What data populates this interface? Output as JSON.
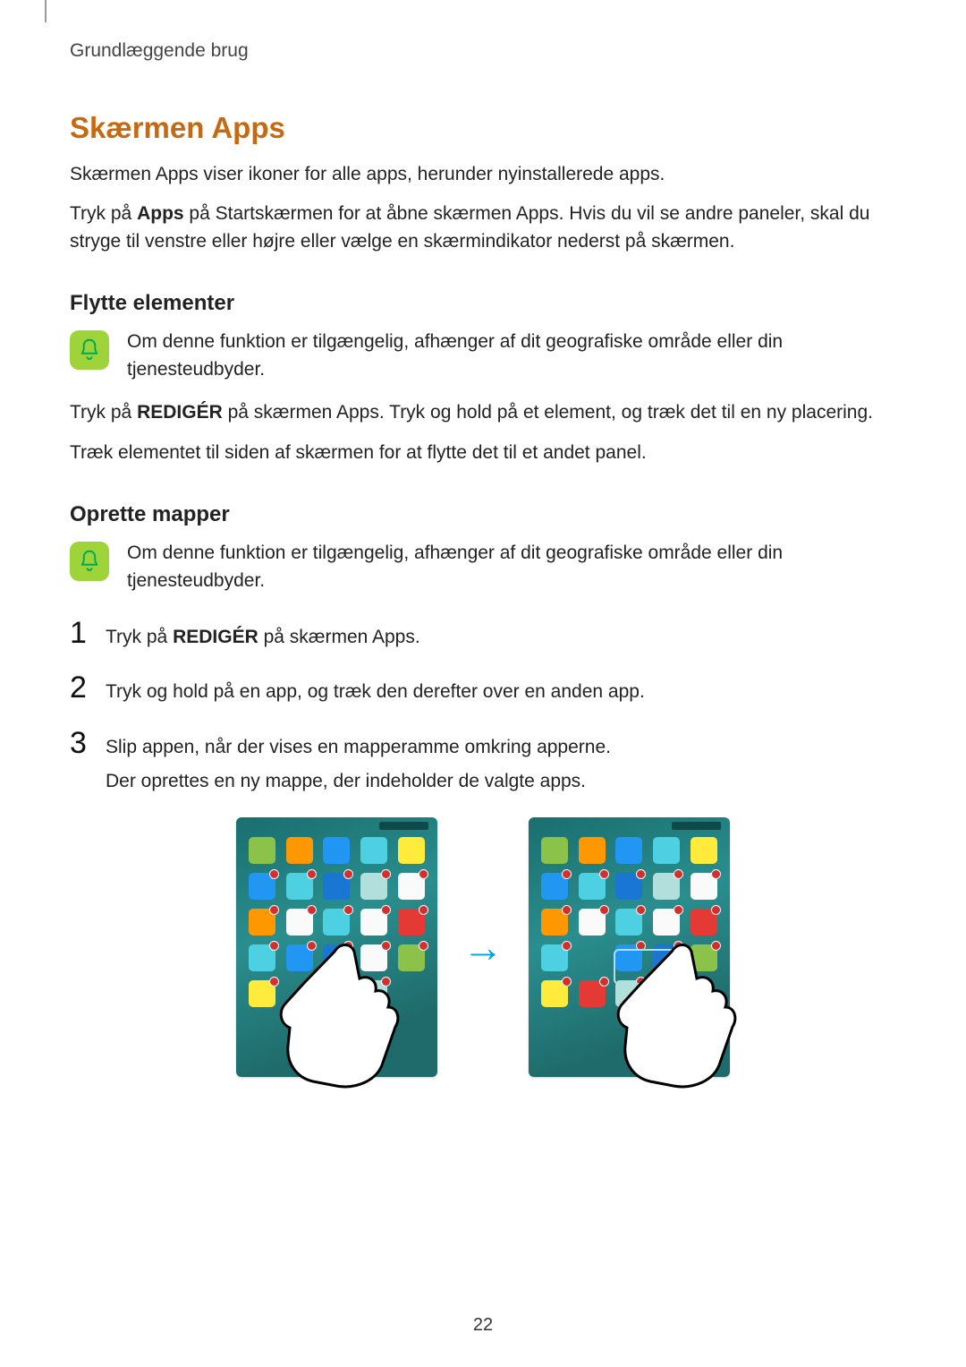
{
  "chapter": "Grundlæggende brug",
  "title": "Skærmen Apps",
  "intro1": "Skærmen Apps viser ikoner for alle apps, herunder nyinstallerede apps.",
  "intro2_pre": "Tryk på ",
  "intro2_bold": "Apps",
  "intro2_post": " på Startskærmen for at åbne skærmen Apps. Hvis du vil se andre paneler, skal du stryge til venstre eller højre eller vælge en skærmindikator nederst på skærmen.",
  "sub1": "Flytte elementer",
  "note1": "Om denne funktion er tilgængelig, afhænger af dit geografiske område eller din tjenesteudbyder.",
  "move1_pre": "Tryk på ",
  "move1_bold": "REDIGÉR",
  "move1_post": " på skærmen Apps. Tryk og hold på et element, og træk det til en ny placering.",
  "move2": "Træk elementet til siden af skærmen for at flytte det til et andet panel.",
  "sub2": "Oprette mapper",
  "note2": "Om denne funktion er tilgængelig, afhænger af dit geografiske område eller din tjenesteudbyder.",
  "step1_pre": "Tryk på ",
  "step1_bold": "REDIGÉR",
  "step1_post": " på skærmen Apps.",
  "step2": "Tryk og hold på en app, og træk den derefter over en anden app.",
  "step3a": "Slip appen, når der vises en mapperamme omkring apperne.",
  "step3b": "Der oprettes en ny mappe, der indeholder de valgte apps.",
  "nums": {
    "1": "1",
    "2": "2",
    "3": "3"
  },
  "pageNumber": "22"
}
